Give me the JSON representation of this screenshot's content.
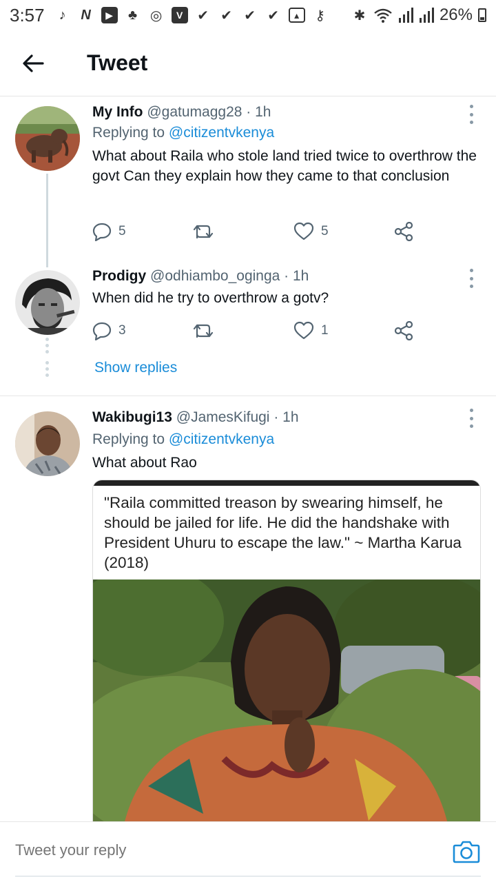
{
  "status_bar": {
    "time": "3:57",
    "battery": "26%",
    "left_icons": [
      "tiktok-icon",
      "netflix-icon",
      "youtube-icon",
      "app-icon",
      "chrome-icon",
      "v-app-icon",
      "check-icon",
      "check-icon",
      "check-icon",
      "check-icon",
      "gallery-icon",
      "key-icon"
    ],
    "right_icons": [
      "bluetooth-icon",
      "wifi-icon",
      "signal-icon",
      "signal-icon"
    ]
  },
  "header": {
    "title": "Tweet"
  },
  "tweets": [
    {
      "name": "My Info",
      "handle": "@gatumagg28",
      "time": "· 1h",
      "replying_prefix": "Replying to",
      "replying_to": "@citizentvkenya",
      "text": "What about Raila who stole land tried twice to overthrow the govt Can they explain how they came to that conclusion",
      "replies": "5",
      "likes": "5"
    },
    {
      "name": "Prodigy",
      "handle": "@odhiambo_oginga",
      "time": "· 1h",
      "text": "When did he try to overthrow a gotv?",
      "replies": "3",
      "likes": "1"
    },
    {
      "name": "Wakibugi13",
      "handle": "@JamesKifugi",
      "time": "· 1h",
      "replying_prefix": "Replying to",
      "replying_to": "@citizentvkenya",
      "text": "What about Rao",
      "quote_text": "\"Raila committed treason by swearing himself, he should be jailed for life. He did the handshake with President Uhuru to escape the law.\" ~ Martha Karua (2018)"
    }
  ],
  "show_replies": "Show replies",
  "reply_bar": {
    "placeholder": "Tweet your reply"
  },
  "colors": {
    "link": "#1a8cd8",
    "muted": "#536471",
    "text": "#0f1419"
  }
}
